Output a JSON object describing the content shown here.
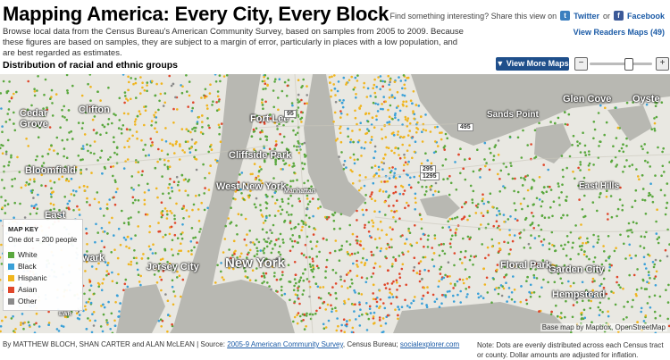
{
  "header": {
    "title": "Mapping America: Every City, Every Block",
    "intro": "Browse local data from the Census Bureau's American Community Survey, based on samples from 2005 to 2009. Because these figures are based on samples, they are subject to a margin of error, particularly in places with a low population, and are best regarded as estimates.",
    "share_prompt": "Find something interesting? Share this view on",
    "twitter_label": "Twitter",
    "or_text": "or",
    "facebook_label": "Facebook",
    "readers_maps": "View Readers Maps (49)"
  },
  "map_toolbar": {
    "subtitle": "Distribution of racial and ethnic groups",
    "view_more": "View More Maps",
    "zoom_out": "−",
    "zoom_in": "+",
    "zoom_level": 0.62
  },
  "legend": {
    "title": "MAP KEY",
    "subtitle": "One dot = 200 people",
    "items": [
      {
        "label": "White",
        "color": "#5aa83e"
      },
      {
        "label": "Black",
        "color": "#3aa0d8"
      },
      {
        "label": "Hispanic",
        "color": "#f0b51e"
      },
      {
        "label": "Asian",
        "color": "#e0462a"
      },
      {
        "label": "Other",
        "color": "#8a8a8a"
      }
    ]
  },
  "places": {
    "cedar": "Cedar",
    "grove": "Grove",
    "clifton": "Clifton",
    "bloomfield": "Bloomfield",
    "fort_lee": "Fort Lee",
    "cliffside_park": "Cliffside Park",
    "west_new_york": "West New York",
    "jersey_city": "Jersey City",
    "new_york": "New York",
    "east": "East",
    "wark": "wark",
    "ewr": "EWR",
    "sands_point": "Sands Point",
    "glen_cove": "Glen Cove",
    "oyster": "Oyste",
    "east_hills": "East Hills",
    "garden_city": "Garden City",
    "hempstead": "Hempstead",
    "floral_park": "Floral Park",
    "manhattan": "Manhattan",
    "shield_95": "95",
    "shield_495": "495",
    "shield_295": "295",
    "shield_1295": "1295"
  },
  "attribution": "Base map by Mapbox, OpenStreetMap",
  "footer": {
    "byline": "By MATTHEW BLOCH, SHAN CARTER and ALAN McLEAN | Source: ",
    "source_link": "2005-9 American Community Survey",
    "mid": ", Census Bureau; ",
    "explorer_link": "socialexplorer.com",
    "note": "Note: Dots are evenly distributed across each Census tract or county. Dollar amounts are adjusted for inflation."
  },
  "colors": {
    "white": "#5aa83e",
    "black": "#3aa0d8",
    "hispanic": "#f0b51e",
    "asian": "#e0462a",
    "other": "#8a8a8a",
    "water": "#b8b8b2",
    "land": "#e9e8e2",
    "link": "#1a5aa6"
  }
}
